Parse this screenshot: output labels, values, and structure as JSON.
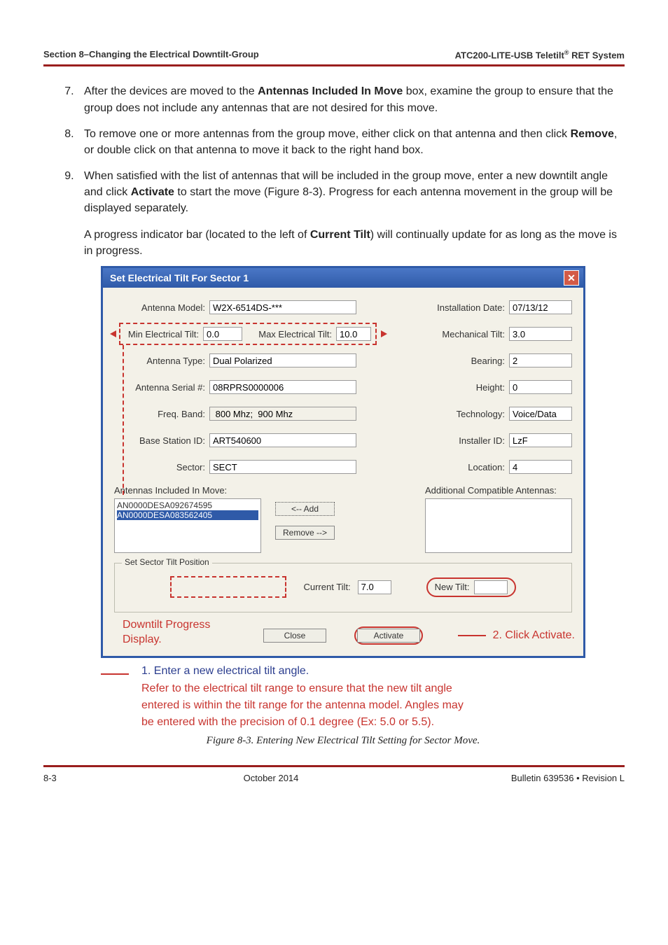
{
  "header": {
    "left": "Section 8–Changing the Electrical Downtilt-Group",
    "right_prefix": "ATC200-LITE-USB Teletilt",
    "right_sup": "®",
    "right_suffix": " RET System"
  },
  "list": {
    "start": 7,
    "items": [
      "After the devices are moved to the <b>Antennas Included In Move</b> box, examine the group to ensure that the group does not include any antennas that are not desired for this move.",
      "To remove one or more antennas from the group move, either click on that antenna and then click <b>Remove</b>, or double click on that antenna to move it back to the right hand box.",
      "When satisfied with the list of antennas that will be included in the group move, enter a new downtilt angle and click <b>Activate</b> to start the move (Figure 8-3). Progress for each antenna movement in the group will be displayed separately."
    ],
    "after9": "A progress indicator bar (located to the left of <b>Current Tilt</b>) will continually update for as long as the move is in progress."
  },
  "dlg": {
    "title": "Set Electrical Tilt For Sector 1",
    "close_glyph": "✕",
    "labels": {
      "antenna_model": "Antenna Model:",
      "install_date": "Installation Date:",
      "min_tilt": "Min Electrical Tilt:",
      "max_tilt": "Max Electrical Tilt:",
      "mech_tilt": "Mechanical Tilt:",
      "antenna_type": "Antenna Type:",
      "bearing": "Bearing:",
      "serial": "Antenna Serial #:",
      "height": "Height:",
      "freq": "Freq. Band:",
      "tech": "Technology:",
      "base_id": "Base Station ID:",
      "installer": "Installer ID:",
      "sector": "Sector:",
      "location": "Location:",
      "included": "Antennas Included In Move:",
      "compat": "Additional Compatible Antennas:",
      "sector_tilt": "Set Sector Tilt Position",
      "cur_tilt": "Current Tilt:",
      "new_tilt": "New Tilt:"
    },
    "values": {
      "antenna_model": "W2X-6514DS-***",
      "install_date": "07/13/12",
      "min_tilt": "0.0",
      "max_tilt": "10.0",
      "mech_tilt": "3.0",
      "antenna_type": "Dual Polarized",
      "bearing": "2",
      "serial": "08RPRS0000006",
      "height": "0",
      "freq": " 800 Mhz;  900 Mhz",
      "tech": "Voice/Data",
      "base_id": "ART540600",
      "installer": "LzF",
      "sector": "SECT",
      "location": "4",
      "cur_tilt": "7.0",
      "new_tilt": ""
    },
    "included_list": [
      "AN0000DESA092674595",
      "AN0000DESA083562405"
    ],
    "selected_index": 1,
    "buttons": {
      "add": "<-- Add",
      "remove": "Remove -->",
      "close": "Close",
      "activate": "Activate"
    }
  },
  "annotations": {
    "downtilt": "Downtilt Progress Display.",
    "click_activate": "2. Click Activate.",
    "step1": "1.  Enter a new electrical tilt angle.",
    "note_l1": "Refer to the electrical tilt range to ensure that the new tilt angle",
    "note_l2": "entered is within the tilt range for the antenna model. Angles may",
    "note_l3": "be entered with the precision of 0.1 degree (Ex: 5.0 or 5.5).",
    "caption": "Figure 8-3. Entering New Electrical Tilt Setting for Sector Move."
  },
  "footer": {
    "pageno": "8-3",
    "center": "October 2014",
    "right": "Bulletin 639536  •  Revision L"
  },
  "chart_data": {
    "type": "table",
    "title": "Set Electrical Tilt For Sector 1 — form field values",
    "columns": [
      "Field",
      "Value"
    ],
    "rows": [
      [
        "Antenna Model",
        "W2X-6514DS-***"
      ],
      [
        "Installation Date",
        "07/13/12"
      ],
      [
        "Min Electrical Tilt",
        "0.0"
      ],
      [
        "Max Electrical Tilt",
        "10.0"
      ],
      [
        "Mechanical Tilt",
        "3.0"
      ],
      [
        "Antenna Type",
        "Dual Polarized"
      ],
      [
        "Bearing",
        "2"
      ],
      [
        "Antenna Serial #",
        "08RPRS0000006"
      ],
      [
        "Height",
        "0"
      ],
      [
        "Freq. Band",
        "800 Mhz; 900 Mhz"
      ],
      [
        "Technology",
        "Voice/Data"
      ],
      [
        "Base Station ID",
        "ART540600"
      ],
      [
        "Installer ID",
        "LzF"
      ],
      [
        "Sector",
        "SECT"
      ],
      [
        "Location",
        "4"
      ],
      [
        "Current Tilt",
        "7.0"
      ],
      [
        "New Tilt",
        ""
      ]
    ]
  }
}
